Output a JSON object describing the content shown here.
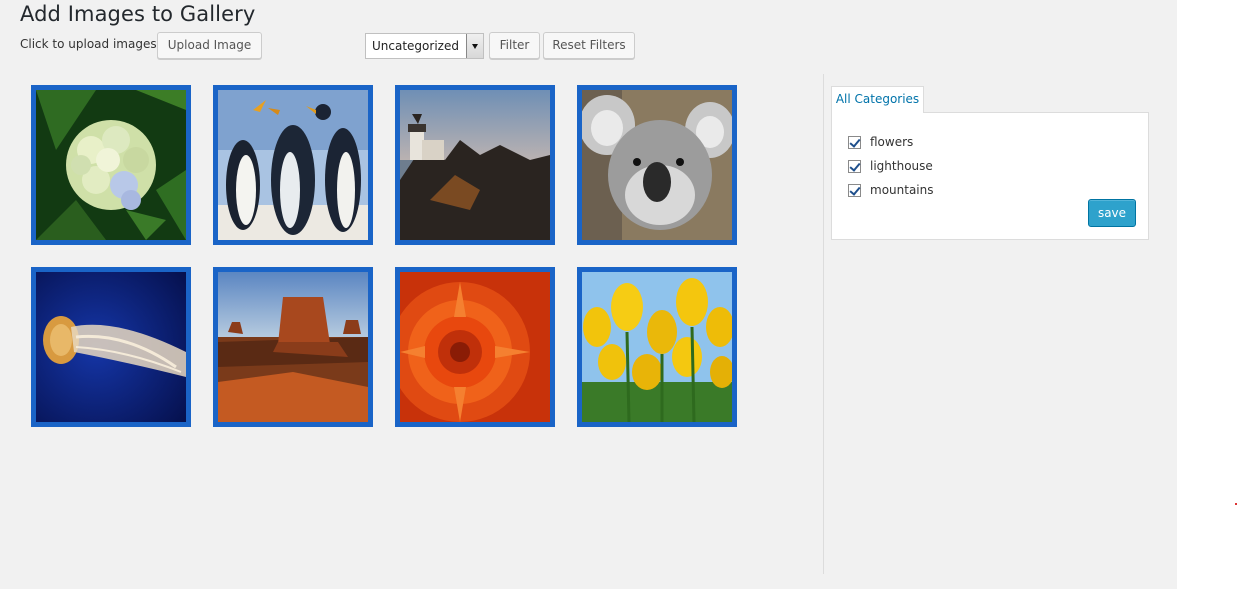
{
  "header": {
    "title": "Add Images to Gallery",
    "upload_hint": "Click to upload images",
    "upload_button": "Upload Image"
  },
  "filter": {
    "selected_category": "Uncategorized",
    "filter_button": "Filter",
    "reset_button": "Reset Filters"
  },
  "gallery": {
    "images": [
      "hydrangea",
      "penguins",
      "lighthouse",
      "koala",
      "jellyfish",
      "desert",
      "chrysanthemum",
      "tulips"
    ]
  },
  "categories": {
    "tab_label": "All Categories",
    "items": [
      {
        "label": "flowers",
        "checked": true
      },
      {
        "label": "lighthouse",
        "checked": true
      },
      {
        "label": "mountains",
        "checked": true
      }
    ],
    "save_button": "save"
  },
  "colors": {
    "thumb_border": "#1a64c7",
    "save_button": "#2ea2cc",
    "link": "#0073aa",
    "background": "#f1f1f1"
  }
}
